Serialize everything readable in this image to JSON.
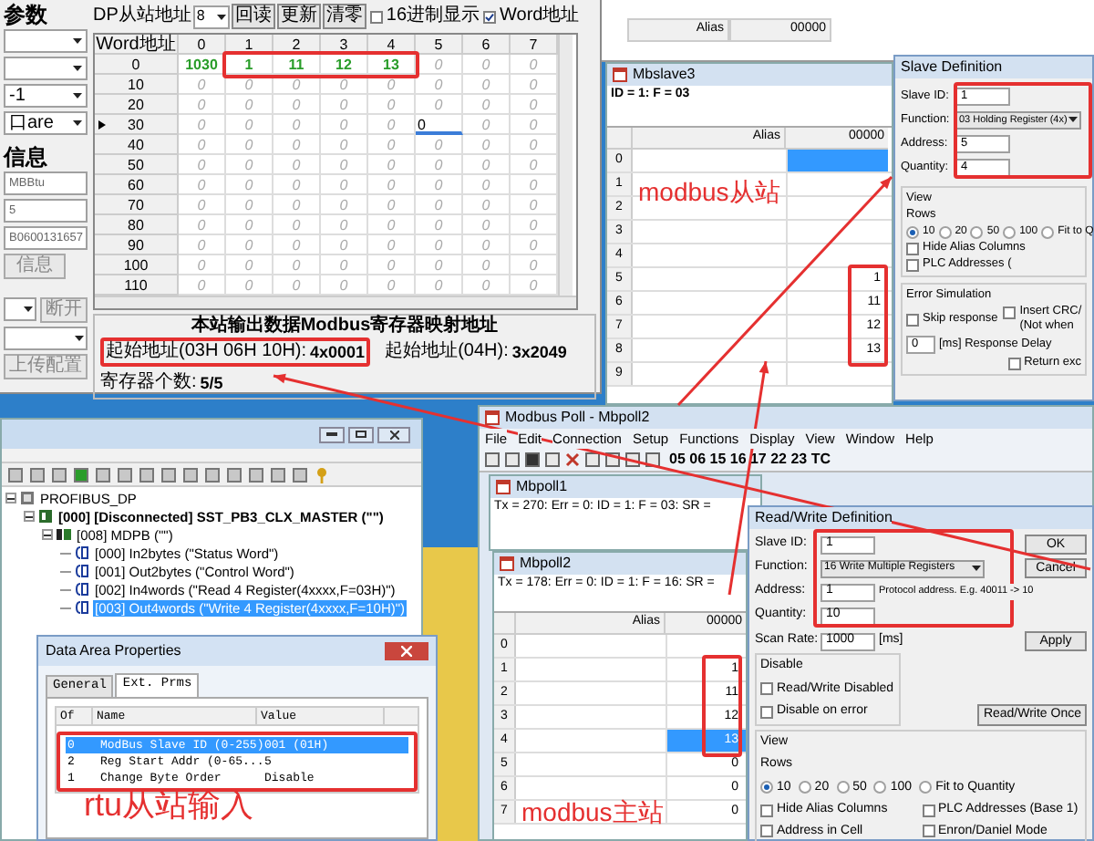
{
  "config_tool": {
    "params_group": {
      "title": "参数",
      "dropdowns": [
        "-1",
        "口are"
      ]
    },
    "info_group": {
      "title": "信息",
      "fields": [
        "MBBtu",
        "5",
        "B0600131657"
      ],
      "button": "信息"
    },
    "action_group": {
      "button_1": "断开",
      "button_2": "上传配置"
    },
    "toolbar": {
      "slave_addr_label": "DP从站地址",
      "slave_addr": "8",
      "buttons": [
        "回读",
        "更新",
        "清零"
      ],
      "checkboxes": [
        {
          "label": "16进制显示",
          "checked": false
        },
        {
          "label": "Word地址",
          "checked": true
        }
      ]
    },
    "grid": {
      "corner": "Word地址",
      "columns": [
        "0",
        "1",
        "2",
        "3",
        "4",
        "5",
        "6",
        "7"
      ],
      "rows": [
        {
          "label": "0",
          "current": false,
          "cells": [
            {
              "value": "1030",
              "kind": "changed"
            },
            {
              "value": "1",
              "kind": "changed"
            },
            {
              "value": "11",
              "kind": "changed"
            },
            {
              "value": "12",
              "kind": "changed"
            },
            {
              "value": "13",
              "kind": "changed"
            },
            "0",
            "0",
            "0"
          ]
        },
        {
          "label": "10",
          "current": false,
          "cells": [
            "0",
            "0",
            "0",
            "0",
            "0",
            "0",
            "0",
            "0"
          ]
        },
        {
          "label": "20",
          "current": false,
          "cells": [
            "0",
            "0",
            "0",
            "0",
            "0",
            "0",
            "0",
            "0"
          ]
        },
        {
          "label": "30",
          "current": true,
          "cells": [
            "0",
            "0",
            "0",
            "0",
            "0",
            {
              "value": "0",
              "kind": "editing"
            },
            "0",
            "0"
          ]
        },
        {
          "label": "40",
          "current": false,
          "cells": [
            "0",
            "0",
            "0",
            "0",
            "0",
            "0",
            "0",
            "0"
          ]
        },
        {
          "label": "50",
          "current": false,
          "cells": [
            "0",
            "0",
            "0",
            "0",
            "0",
            "0",
            "0",
            "0"
          ]
        },
        {
          "label": "60",
          "current": false,
          "cells": [
            "0",
            "0",
            "0",
            "0",
            "0",
            "0",
            "0",
            "0"
          ]
        },
        {
          "label": "70",
          "current": false,
          "cells": [
            "0",
            "0",
            "0",
            "0",
            "0",
            "0",
            "0",
            "0"
          ]
        },
        {
          "label": "80",
          "current": false,
          "cells": [
            "0",
            "0",
            "0",
            "0",
            "0",
            "0",
            "0",
            "0"
          ]
        },
        {
          "label": "90",
          "current": false,
          "cells": [
            "0",
            "0",
            "0",
            "0",
            "0",
            "0",
            "0",
            "0"
          ]
        },
        {
          "label": "100",
          "current": false,
          "cells": [
            "0",
            "0",
            "0",
            "0",
            "0",
            "0",
            "0",
            "0"
          ]
        },
        {
          "label": "110",
          "current": false,
          "cells": [
            "0",
            "0",
            "0",
            "0",
            "0",
            "0",
            "0",
            "0"
          ]
        }
      ]
    },
    "mapping": {
      "title": "本站输出数据Modbus寄存器映射地址",
      "fields": [
        {
          "label": "起始地址(03H 06H 10H):",
          "value": "4x0001"
        },
        {
          "label": "起始地址(04H):",
          "value": "3x2049"
        },
        {
          "label": "寄存器个数:",
          "value": "5/5"
        }
      ]
    }
  },
  "slave_back_window": {
    "columns": [
      "Alias",
      "00000"
    ]
  },
  "mbslave": {
    "title": "Mbslave3",
    "status": "ID = 1: F = 03",
    "columns": [
      "Alias",
      "00000"
    ],
    "rows": [
      {
        "label": "0",
        "selected": true
      },
      {
        "label": "1",
        "selected": false
      },
      {
        "label": "2",
        "selected": false
      },
      {
        "label": "3",
        "selected": false
      },
      {
        "label": "4",
        "selected": false
      },
      {
        "label": "5",
        "value": "1",
        "selected": false
      },
      {
        "label": "6",
        "value": "11",
        "selected": false
      },
      {
        "label": "7",
        "value": "12",
        "selected": false
      },
      {
        "label": "8",
        "value": "13",
        "selected": false
      },
      {
        "label": "9",
        "selected": false
      }
    ]
  },
  "slave_definition": {
    "title": "Slave Definition",
    "fields": [
      {
        "label": "Slave ID:",
        "value": "1",
        "kind": "text"
      },
      {
        "label": "Function:",
        "value": "03 Holding Register (4x)",
        "kind": "select"
      },
      {
        "label": "Address:",
        "value": "5",
        "kind": "text"
      },
      {
        "label": "Quantity:",
        "value": "4",
        "kind": "text"
      }
    ],
    "view": {
      "title": "View",
      "rows_label": "Rows",
      "radios": [
        {
          "label": "10",
          "selected": true
        },
        {
          "label": "20",
          "selected": false
        },
        {
          "label": "50",
          "selected": false
        },
        {
          "label": "100",
          "selected": false
        },
        {
          "label": "Fit to Q",
          "selected": false
        }
      ],
      "checkboxes": [
        {
          "label": "Hide Alias Columns",
          "checked": false
        },
        {
          "label": "PLC Addresses (",
          "checked": false
        }
      ]
    },
    "error_simulation": {
      "title": "Error Simulation",
      "checkboxes": [
        {
          "label": "Skip response",
          "checked": false
        },
        {
          "label": "Insert CRC/",
          "checked": false
        },
        {
          "label": "Return exc",
          "checked": false
        }
      ],
      "note": "(Not when",
      "delay_value": "0",
      "delay_label": "[ms] Response Delay"
    }
  },
  "network_config": {
    "tree": [
      {
        "label": "PROFIBUS_DP",
        "kind": "network",
        "selected": false,
        "children": [
          {
            "label": "[000] [Disconnected] SST_PB3_CLX_MASTER (\"\")",
            "kind": "master",
            "selected": false,
            "children": [
              {
                "label": "[008] MDPB (\"\")",
                "kind": "slave",
                "selected": false,
                "children": [
                  {
                    "label": "[000] In2bytes (\"Status Word\")",
                    "kind": "module",
                    "selected": false
                  },
                  {
                    "label": "[001] Out2bytes (\"Control Word\")",
                    "kind": "module",
                    "selected": false
                  },
                  {
                    "label": "[002] In4words (\"Read 4 Register(4xxxx,F=03H)\")",
                    "kind": "module",
                    "selected": false
                  },
                  {
                    "label": "[003] Out4words (\"Write 4 Register(4xxxx,F=10H)\")",
                    "kind": "module",
                    "selected": true
                  }
                ]
              }
            ]
          }
        ]
      }
    ]
  },
  "data_area": {
    "title": "Data Area Properties",
    "tabs": [
      {
        "label": "General",
        "selected": false
      },
      {
        "label": "Ext. Prms",
        "selected": true
      }
    ],
    "columns": [
      "Of",
      "Name",
      "Value"
    ],
    "rows": [
      {
        "cells": [
          "0",
          "ModBus Slave ID (0-255)",
          "001 (01H)"
        ],
        "selected": true
      },
      {
        "cells": [
          "2",
          "Reg Start Addr (0-65...",
          "5"
        ],
        "selected": false
      },
      {
        "cells": [
          "1",
          "Change Byte Order",
          "Disable"
        ],
        "selected": false
      }
    ]
  },
  "modbus_poll": {
    "title": "Modbus Poll - Mbpoll2",
    "menu": [
      "File",
      "Edit",
      "Connection",
      "Setup",
      "Functions",
      "Display",
      "View",
      "Window",
      "Help"
    ],
    "toolbar_codes": "05 06 15 16 17 22 23 TC",
    "mbpoll1": {
      "title": "Mbpoll1",
      "status": "Tx = 270: Err = 0: ID = 1: F = 03: SR ="
    },
    "mbpoll2": {
      "title": "Mbpoll2",
      "status": "Tx = 178: Err = 0: ID = 1: F = 16: SR =",
      "columns": [
        "Alias",
        "00000"
      ],
      "rows": [
        {
          "label": "0",
          "selected": false
        },
        {
          "label": "1",
          "value": "1",
          "selected": false
        },
        {
          "label": "2",
          "value": "11",
          "selected": false
        },
        {
          "label": "3",
          "value": "12",
          "selected": false
        },
        {
          "label": "4",
          "value": "13",
          "selected": true
        },
        {
          "label": "5",
          "value": "0",
          "selected": false
        },
        {
          "label": "6",
          "value": "0",
          "selected": false
        },
        {
          "label": "7",
          "value": "0",
          "selected": false
        }
      ]
    }
  },
  "rw_definition": {
    "title": "Read/Write Definition",
    "slave_id_label": "Slave ID:",
    "slave_id": "1",
    "function_label": "Function:",
    "function": "16 Write Multiple Registers",
    "address_label": "Address:",
    "address": "1",
    "address_hint": "Protocol address. E.g. 40011 -> 10",
    "quantity_label": "Quantity:",
    "quantity": "10",
    "scan_rate_label": "Scan Rate:",
    "scan_rate": "1000",
    "scan_unit": "[ms]",
    "buttons": {
      "ok": "OK",
      "cancel": "Cancel",
      "apply": "Apply",
      "once": "Read/Write Once"
    },
    "disable": {
      "title": "Disable",
      "checkboxes": [
        {
          "label": "Read/Write Disabled",
          "checked": false
        },
        {
          "label": "Disable on error",
          "checked": false
        }
      ]
    },
    "view": {
      "title": "View",
      "rows_label": "Rows",
      "radios": [
        {
          "label": "10",
          "selected": true
        },
        {
          "label": "20",
          "selected": false
        },
        {
          "label": "50",
          "selected": false
        },
        {
          "label": "100",
          "selected": false
        },
        {
          "label": "Fit to Quantity",
          "selected": false
        }
      ],
      "checkboxes": [
        {
          "label": "Hide Alias Columns",
          "checked": false
        },
        {
          "label": "PLC Addresses (Base 1)",
          "checked": false
        },
        {
          "label": "Address in Cell",
          "checked": false
        },
        {
          "label": "Enron/Daniel Mode",
          "checked": false
        }
      ]
    }
  },
  "annotations": [
    "modbus从站",
    "rtu从站输入",
    "modbus主站"
  ]
}
